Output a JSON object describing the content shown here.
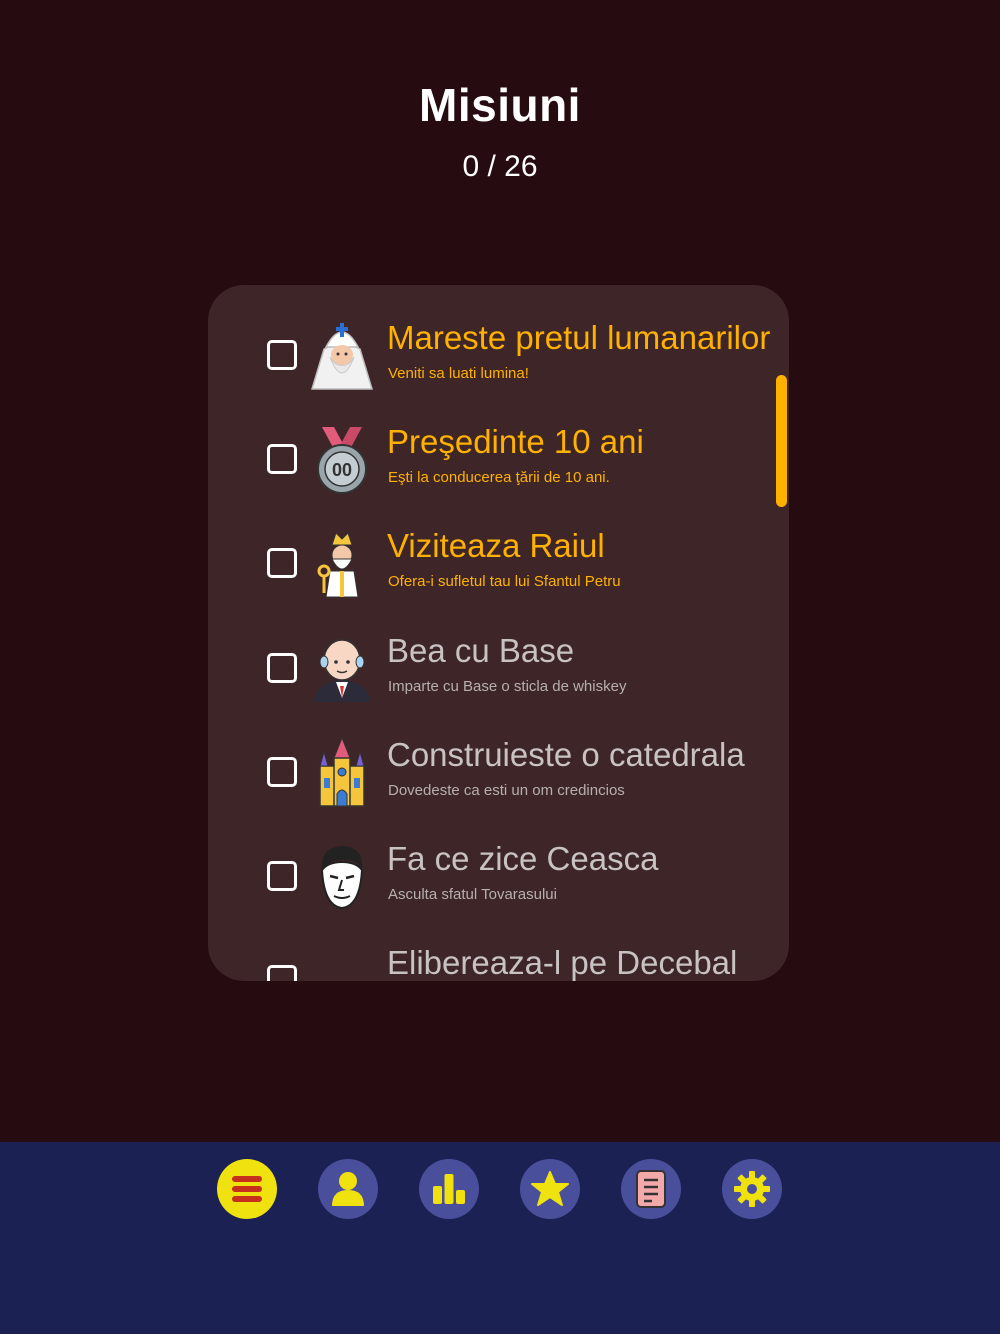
{
  "header": {
    "title": "Misiuni",
    "progress": "0 / 26"
  },
  "colors": {
    "background": "#260c11",
    "panel": "#3d2528",
    "accent": "#ffb100",
    "bottom_bar": "#1b2152",
    "nav_button": "#4a4f9b",
    "nav_selected": "#f0e20e"
  },
  "missions": [
    {
      "title": "Mareste pretul lumanarilor",
      "subtitle": "Veniti sa luati lumina!",
      "icon": "patriarch-icon",
      "checked": false,
      "highlighted": true
    },
    {
      "title": "Preşedinte 10 ani",
      "subtitle": "Eşti la conducerea ţării de 10 ani.",
      "icon": "medal-icon",
      "checked": false,
      "highlighted": true
    },
    {
      "title": "Viziteaza Raiul",
      "subtitle": "Ofera-i sufletul tau lui Sfantul Petru",
      "icon": "saint-peter-icon",
      "checked": false,
      "highlighted": true
    },
    {
      "title": "Bea cu Base",
      "subtitle": "Imparte cu Base o sticla de whiskey",
      "icon": "bald-man-icon",
      "checked": false,
      "highlighted": false
    },
    {
      "title": "Construieste o catedrala",
      "subtitle": "Dovedeste ca esti un om credincios",
      "icon": "cathedral-icon",
      "checked": false,
      "highlighted": false
    },
    {
      "title": "Fa ce zice Ceasca",
      "subtitle": "Asculta sfatul Tovarasului",
      "icon": "leader-face-icon",
      "checked": false,
      "highlighted": false
    },
    {
      "title": "Elibereaza-l pe Decebal",
      "subtitle": "",
      "icon": "statue-icon",
      "checked": false,
      "highlighted": false
    }
  ],
  "nav": [
    {
      "name": "menu",
      "icon": "menu-icon",
      "selected": true
    },
    {
      "name": "profile",
      "icon": "person-icon",
      "selected": false
    },
    {
      "name": "stats",
      "icon": "bar-chart-icon",
      "selected": false
    },
    {
      "name": "favorites",
      "icon": "star-icon",
      "selected": false
    },
    {
      "name": "missions",
      "icon": "checklist-icon",
      "selected": false
    },
    {
      "name": "settings",
      "icon": "gear-icon",
      "selected": false
    }
  ]
}
